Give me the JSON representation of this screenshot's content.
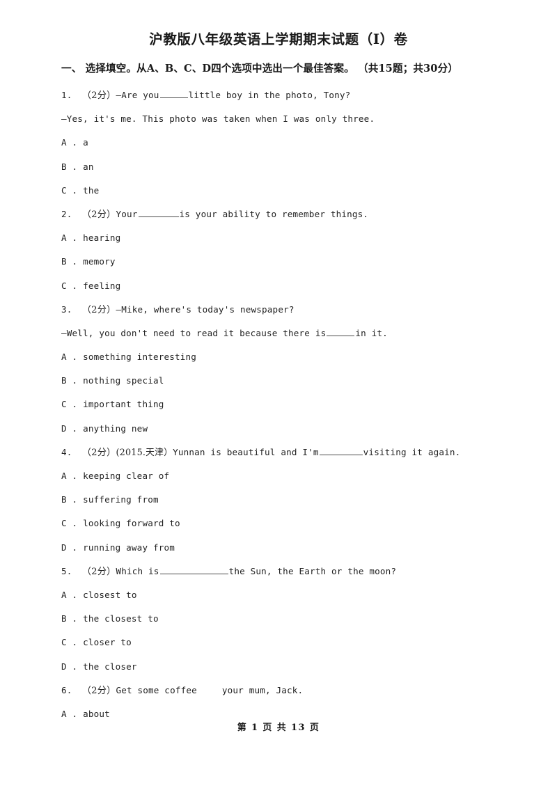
{
  "document": {
    "title": "沪教版八年级英语上学期期末试题（I）卷",
    "section_heading": "一、  选择填空。从A、B、C、D四个选项中选出一个最佳答案。 （共15题；共30分）",
    "footer": "第 1 页 共 13 页"
  },
  "questions": [
    {
      "number": "1.",
      "points": "（2分）",
      "tag": "",
      "stem_before": "—Are you",
      "blank": "w-md",
      "stem_after": "little boy in the photo, Tony?",
      "continuation": "—Yes, it's me. This photo was taken when I was only three.",
      "options": [
        {
          "letter": "A .",
          "text": "a"
        },
        {
          "letter": "B .",
          "text": "an"
        },
        {
          "letter": "C .",
          "text": "the"
        }
      ]
    },
    {
      "number": "2.",
      "points": "（2分）",
      "tag": "",
      "stem_before": "Your",
      "blank": "w-lg",
      "stem_after": "is your ability to remember things.",
      "continuation": "",
      "options": [
        {
          "letter": "A .",
          "text": "hearing"
        },
        {
          "letter": "B .",
          "text": "memory"
        },
        {
          "letter": "C .",
          "text": "feeling"
        }
      ]
    },
    {
      "number": "3.",
      "points": "（2分）",
      "tag": "",
      "stem_before": "—Mike, where's today's newspaper?",
      "blank": "",
      "stem_after": "",
      "continuation_before": "—Well, you don't need to read it because there is",
      "continuation_blank": "w-md",
      "continuation_after": "in it.",
      "options": [
        {
          "letter": "A .",
          "text": "something interesting"
        },
        {
          "letter": "B .",
          "text": "nothing special"
        },
        {
          "letter": "C .",
          "text": "important thing"
        },
        {
          "letter": "D .",
          "text": "anything new"
        }
      ]
    },
    {
      "number": "4.",
      "points": "（2分）",
      "tag": "(2015.天津）",
      "stem_before": "Yunnan is beautiful and I'm",
      "blank": "w-xl",
      "stem_after": "visiting it again.",
      "continuation": "",
      "options": [
        {
          "letter": "A .",
          "text": "keeping clear of"
        },
        {
          "letter": "B .",
          "text": "suffering from"
        },
        {
          "letter": "C .",
          "text": "looking forward to"
        },
        {
          "letter": "D .",
          "text": "running away from"
        }
      ]
    },
    {
      "number": "5.",
      "points": "（2分）",
      "tag": "",
      "stem_before": "Which is",
      "blank": "w-xxl",
      "stem_after": "the Sun, the Earth or the moon?",
      "continuation": "",
      "options": [
        {
          "letter": "A .",
          "text": "closest to"
        },
        {
          "letter": "B .",
          "text": "the closest to"
        },
        {
          "letter": "C .",
          "text": "closer to"
        },
        {
          "letter": "D .",
          "text": "the closer"
        }
      ]
    },
    {
      "number": "6.",
      "points": "（2分）",
      "tag": "",
      "stem_before": "Get some coffee",
      "blank": "none",
      "stem_after": "your mum, Jack.",
      "continuation": "",
      "options": [
        {
          "letter": "A .",
          "text": "about"
        }
      ]
    }
  ]
}
